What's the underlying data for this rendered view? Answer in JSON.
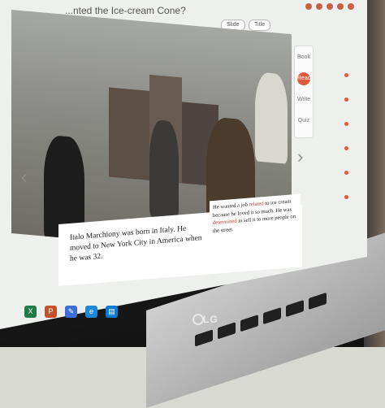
{
  "window": {
    "title": "...nted the Ice-cream Cone?"
  },
  "toolbar": {
    "btn1": "Slide",
    "btn2": "Title"
  },
  "caption": {
    "left_text": "Italo Marchiony was born in Italy. He moved to New York City in America when he was 32.",
    "right_part1": "He wanted a job ",
    "right_word1": "related",
    "right_part2": " to ice cream because he loved it so much. He was ",
    "right_word2": "determined",
    "right_part3": " to sell it to more people on the street."
  },
  "side_panel": {
    "items": [
      "Book",
      "Read",
      "Write",
      "Quiz"
    ]
  },
  "nav": {
    "prev": "‹",
    "next": "›"
  },
  "brand": {
    "logo": "LG"
  },
  "taskbar": {
    "icons": [
      "excel-icon",
      "powerpoint-icon",
      "paint-icon",
      "edge-icon",
      "store-icon"
    ]
  },
  "colors": {
    "accent": "#e05a3b",
    "caption_red": "#c0392b"
  }
}
